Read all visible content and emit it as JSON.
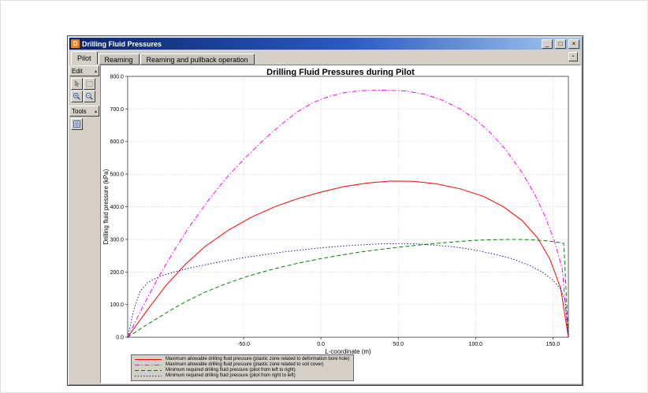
{
  "window": {
    "title": "Drilling Fluid Pressures",
    "icon_glyph": "D",
    "controls": {
      "minimize": "_",
      "maximize": "□",
      "close": "×"
    }
  },
  "tabs": {
    "items": [
      {
        "label": "Pilot",
        "active": true
      },
      {
        "label": "Reaming",
        "active": false
      },
      {
        "label": "Reaming and pullback operation",
        "active": false
      }
    ],
    "corner_glyph": "▪"
  },
  "sidebar": {
    "panels": [
      {
        "label": "Edit",
        "collapse_glyph": "▴",
        "buttons": [
          "pointer",
          "selection-rect",
          "zoom-in",
          "zoom-out"
        ]
      },
      {
        "label": "Tools",
        "collapse_glyph": "▴",
        "buttons": [
          "table"
        ]
      }
    ]
  },
  "chart_data": {
    "type": "line",
    "title": "Drilling Fluid Pressures during Pilot",
    "xlabel": "L-coordinate (m)",
    "ylabel": "Drilling fluid pressure (kPa)",
    "xlim": [
      -125,
      160
    ],
    "ylim": [
      0,
      800
    ],
    "xticks": [
      -50,
      0,
      50,
      100,
      150
    ],
    "yticks": [
      0,
      100,
      200,
      300,
      400,
      500,
      600,
      700,
      800
    ],
    "grid": true,
    "legend_position": "bottom-left",
    "series": [
      {
        "name": "Maximum allowable drilling fluid pressure (plastic zone related to deformation bore hole)",
        "color": "#ff0000",
        "style": "solid",
        "points": [
          [
            -125,
            0
          ],
          [
            -112,
            85
          ],
          [
            -100,
            160
          ],
          [
            -88,
            222
          ],
          [
            -75,
            278
          ],
          [
            -60,
            328
          ],
          [
            -45,
            368
          ],
          [
            -30,
            400
          ],
          [
            -15,
            425
          ],
          [
            0,
            445
          ],
          [
            15,
            462
          ],
          [
            30,
            473
          ],
          [
            45,
            479
          ],
          [
            60,
            478
          ],
          [
            75,
            470
          ],
          [
            90,
            455
          ],
          [
            105,
            432
          ],
          [
            118,
            400
          ],
          [
            130,
            358
          ],
          [
            140,
            305
          ],
          [
            148,
            240
          ],
          [
            155,
            150
          ],
          [
            160,
            0
          ]
        ]
      },
      {
        "name": "Maximum allowable drilling fluid pressure (plastic zone related to soil cover)",
        "color": "#ff00ff",
        "style": "dashdot",
        "points": [
          [
            -125,
            0
          ],
          [
            -115,
            95
          ],
          [
            -105,
            185
          ],
          [
            -95,
            265
          ],
          [
            -85,
            340
          ],
          [
            -72,
            425
          ],
          [
            -60,
            495
          ],
          [
            -48,
            555
          ],
          [
            -36,
            610
          ],
          [
            -25,
            655
          ],
          [
            -15,
            692
          ],
          [
            -5,
            720
          ],
          [
            5,
            738
          ],
          [
            15,
            750
          ],
          [
            25,
            756
          ],
          [
            40,
            758
          ],
          [
            55,
            755
          ],
          [
            67,
            745
          ],
          [
            78,
            728
          ],
          [
            90,
            700
          ],
          [
            100,
            668
          ],
          [
            110,
            625
          ],
          [
            120,
            572
          ],
          [
            130,
            505
          ],
          [
            138,
            440
          ],
          [
            145,
            370
          ],
          [
            151,
            295
          ],
          [
            156,
            210
          ],
          [
            160,
            0
          ]
        ]
      },
      {
        "name": "Minimum required drilling fluid pressure (pilot from left to right)",
        "color": "#008000",
        "style": "dashed",
        "points": [
          [
            -125,
            0
          ],
          [
            -112,
            40
          ],
          [
            -100,
            75
          ],
          [
            -88,
            108
          ],
          [
            -75,
            138
          ],
          [
            -62,
            163
          ],
          [
            -50,
            183
          ],
          [
            -38,
            200
          ],
          [
            -25,
            216
          ],
          [
            -12,
            230
          ],
          [
            0,
            241
          ],
          [
            12,
            251
          ],
          [
            25,
            261
          ],
          [
            38,
            269
          ],
          [
            50,
            276
          ],
          [
            62,
            282
          ],
          [
            75,
            288
          ],
          [
            88,
            293
          ],
          [
            100,
            297
          ],
          [
            112,
            299
          ],
          [
            125,
            300
          ],
          [
            135,
            299
          ],
          [
            145,
            296
          ],
          [
            152,
            292
          ],
          [
            157,
            288
          ],
          [
            160,
            0
          ]
        ]
      },
      {
        "name": "Minimum required drilling fluid pressure (pilot from right to left)",
        "color": "#000099",
        "style": "dotted",
        "points": [
          [
            -125,
            0
          ],
          [
            -121,
            85
          ],
          [
            -117,
            140
          ],
          [
            -112,
            168
          ],
          [
            -105,
            185
          ],
          [
            -95,
            200
          ],
          [
            -85,
            212
          ],
          [
            -75,
            222
          ],
          [
            -62,
            234
          ],
          [
            -50,
            244
          ],
          [
            -38,
            252
          ],
          [
            -25,
            261
          ],
          [
            -12,
            268
          ],
          [
            0,
            274
          ],
          [
            12,
            279
          ],
          [
            25,
            283
          ],
          [
            38,
            286
          ],
          [
            50,
            287
          ],
          [
            62,
            286
          ],
          [
            75,
            282
          ],
          [
            88,
            276
          ],
          [
            100,
            267
          ],
          [
            112,
            255
          ],
          [
            124,
            240
          ],
          [
            135,
            220
          ],
          [
            143,
            200
          ],
          [
            150,
            175
          ],
          [
            155,
            148
          ],
          [
            158,
            110
          ],
          [
            160,
            0
          ]
        ]
      }
    ]
  }
}
